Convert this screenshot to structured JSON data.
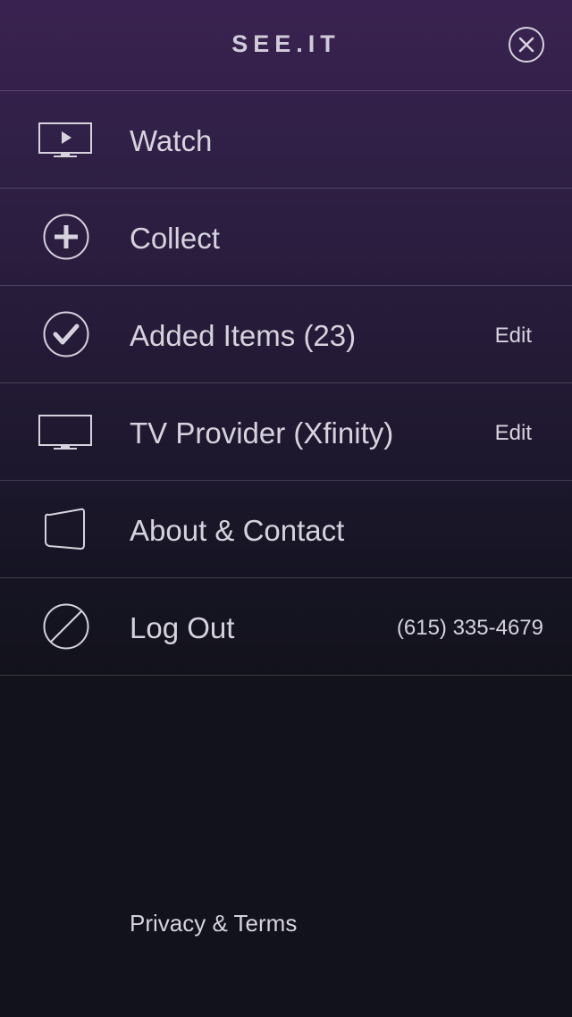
{
  "app": {
    "title": "SEE.IT"
  },
  "menu": {
    "items": [
      {
        "label": "Watch",
        "icon": "tv-play-icon"
      },
      {
        "label": "Collect",
        "icon": "plus-circle-icon"
      },
      {
        "label": "Added Items (23)",
        "icon": "check-circle-icon",
        "action": "Edit"
      },
      {
        "label": "TV Provider (Xfinity)",
        "icon": "tv-icon",
        "action": "Edit"
      },
      {
        "label": "About & Contact",
        "icon": "speech-card-icon"
      },
      {
        "label": "Log Out",
        "icon": "slash-circle-icon",
        "detail": "(615) 335-4679"
      }
    ]
  },
  "footer": {
    "link": "Privacy & Terms"
  },
  "colors": {
    "text": "#d6d3de",
    "top_background": "#3a2250",
    "bottom_background": "#12121c"
  }
}
